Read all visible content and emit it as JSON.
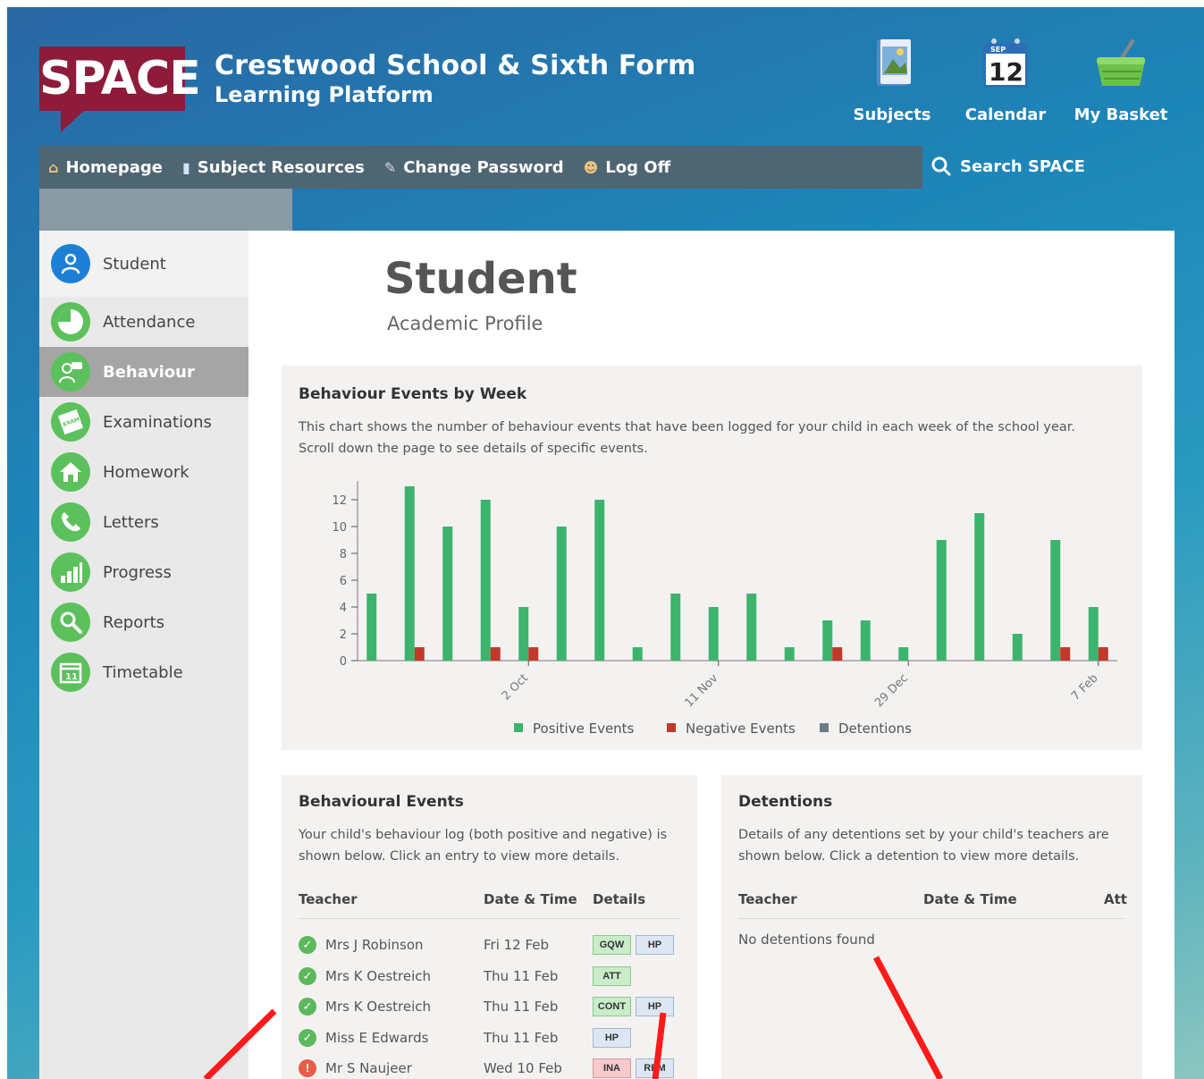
{
  "header": {
    "logo": "SPACE",
    "school_name": "Crestwood School & Sixth Form",
    "school_sub": "Learning Platform",
    "links": [
      {
        "label": "Subjects",
        "icon": "subjects-book-icon"
      },
      {
        "label": "Calendar",
        "icon": "calendar-icon",
        "calendar_month": "SEP",
        "calendar_day": "12"
      },
      {
        "label": "My Basket",
        "icon": "basket-icon"
      }
    ]
  },
  "nav": {
    "items": [
      {
        "label": "Homepage",
        "icon": "home-icon"
      },
      {
        "label": "Subject Resources",
        "icon": "book-icon"
      },
      {
        "label": "Change Password",
        "icon": "key-icon"
      },
      {
        "label": "Log Off",
        "icon": "user-icon"
      }
    ],
    "search_label": "Search SPACE"
  },
  "sidebar": {
    "items": [
      {
        "label": "Student",
        "icon": "student-icon",
        "color": "#1e7fd6"
      },
      {
        "label": "Attendance",
        "icon": "pie-icon",
        "color": "#5cc15c"
      },
      {
        "label": "Behaviour",
        "icon": "chat-user-icon",
        "color": "#5cc15c",
        "active": true
      },
      {
        "label": "Examinations",
        "icon": "exam-icon",
        "color": "#5cc15c",
        "badge": "EXAM"
      },
      {
        "label": "Homework",
        "icon": "home-icon",
        "color": "#5cc15c"
      },
      {
        "label": "Letters",
        "icon": "phone-icon",
        "color": "#5cc15c"
      },
      {
        "label": "Progress",
        "icon": "bar-chart-icon",
        "color": "#5cc15c"
      },
      {
        "label": "Reports",
        "icon": "search-icon",
        "color": "#5cc15c"
      },
      {
        "label": "Timetable",
        "icon": "calendar-icon",
        "color": "#5cc15c",
        "badge": "11"
      }
    ]
  },
  "page": {
    "title": "Student",
    "subtitle": "Academic Profile"
  },
  "chart_card": {
    "title": "Behaviour Events by Week",
    "description": "This chart shows the number of behaviour events that have been logged for your child in each week of the school year. Scroll down the page to see details of specific events."
  },
  "chart_data": {
    "type": "bar",
    "x_ticks": [
      "2 Oct",
      "11 Nov",
      "29 Dec",
      "7 Feb"
    ],
    "y_ticks": [
      0,
      2,
      4,
      6,
      8,
      10,
      12
    ],
    "ylim": [
      0,
      13
    ],
    "week_count": 20,
    "tick_positions": [
      4.5,
      9.5,
      14.5,
      19.5
    ],
    "series": [
      {
        "name": "Positive Events",
        "color": "#3cb46e",
        "values": [
          5,
          13,
          10,
          12,
          4,
          10,
          12,
          1,
          5,
          4,
          5,
          1,
          3,
          3,
          1,
          9,
          11,
          2,
          9,
          4
        ]
      },
      {
        "name": "Negative Events",
        "color": "#c0392b",
        "values": [
          0,
          1,
          0,
          1,
          1,
          0,
          0,
          0,
          0,
          0,
          0,
          0,
          1,
          0,
          0,
          0,
          0,
          0,
          1,
          1
        ]
      },
      {
        "name": "Detentions",
        "color": "#6c7a89",
        "values": [
          0,
          0,
          0,
          0,
          0,
          0,
          0,
          0,
          0,
          0,
          0,
          0,
          0,
          0,
          0,
          0,
          0,
          0,
          0,
          0
        ]
      }
    ],
    "legend": "bottom"
  },
  "events": {
    "title": "Behavioural Events",
    "description": "Your child's behaviour log (both positive and negative) is shown below. Click an entry to view more details.",
    "columns": [
      "Teacher",
      "Date & Time",
      "Details"
    ],
    "rows": [
      {
        "status": "positive",
        "teacher": "Mrs J Robinson",
        "date": "Fri 12 Feb",
        "tags": [
          {
            "t": "GQW",
            "c": "g"
          },
          {
            "t": "HP",
            "c": "b"
          }
        ]
      },
      {
        "status": "positive",
        "teacher": "Mrs K Oestreich",
        "date": "Thu 11 Feb",
        "tags": [
          {
            "t": "ATT",
            "c": "g"
          }
        ]
      },
      {
        "status": "positive",
        "teacher": "Mrs K Oestreich",
        "date": "Thu 11 Feb",
        "tags": [
          {
            "t": "CONT",
            "c": "g"
          },
          {
            "t": "HP",
            "c": "b"
          }
        ]
      },
      {
        "status": "positive",
        "teacher": "Miss E Edwards",
        "date": "Thu 11 Feb",
        "tags": [
          {
            "t": "HP",
            "c": "b"
          }
        ]
      },
      {
        "status": "negative",
        "teacher": "Mr S Naujeer",
        "date": "Wed 10 Feb",
        "tags": [
          {
            "t": "INA",
            "c": "r"
          },
          {
            "t": "REM",
            "c": "b"
          }
        ]
      }
    ]
  },
  "detentions": {
    "title": "Detentions",
    "description": "Details of any detentions set by your child's teachers are shown below. Click a detention to view more details.",
    "columns": [
      "Teacher",
      "Date & Time",
      "Att"
    ],
    "empty": "No detentions found"
  },
  "colors": {
    "brand": "#8e1b3a",
    "nav": "#4e6572",
    "annotation": "#ff1a1a"
  }
}
